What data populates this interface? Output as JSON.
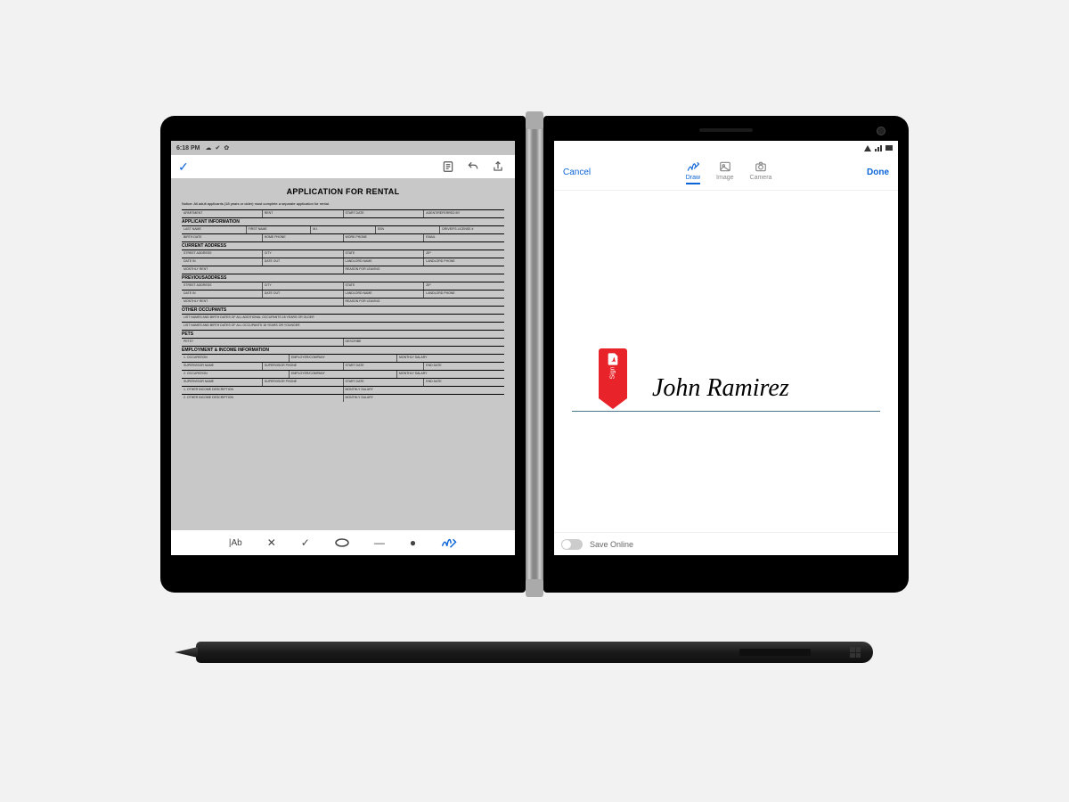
{
  "status": {
    "time": "6:18 PM"
  },
  "left_toolbar": {
    "tools": [
      "properties",
      "undo",
      "share"
    ]
  },
  "document": {
    "title": "APPLICATION FOR RENTAL",
    "notice": "Notice: All adult applicants (18 years or older) must complete a separate application for rental.",
    "row_top": [
      "APARTMENT",
      "RENT",
      "START DATE",
      "AGENT/REFERRED BY"
    ],
    "sections": [
      {
        "heading": "APPLICANT INFORMATION",
        "rows": [
          [
            "LAST NAME",
            "FIRST NAME",
            "M.I.",
            "SSN",
            "DRIVER'S LICENSE #"
          ],
          [
            "BIRTH DATE",
            "HOME PHONE",
            "WORK PHONE",
            "EMAIL"
          ]
        ]
      },
      {
        "heading": "CURRENT ADDRESS",
        "rows": [
          [
            "STREET ADDRESS",
            "CITY",
            "STATE",
            "ZIP"
          ],
          [
            "DATE IN",
            "DATE OUT",
            "LANDLORD NAME",
            "LANDLORD PHONE"
          ],
          [
            "MONTHLY RENT",
            "REASON FOR LEAVING"
          ]
        ]
      },
      {
        "heading": "PREVIOUSADDRESS",
        "rows": [
          [
            "STREET ADDRESS",
            "CITY",
            "STATE",
            "ZIP"
          ],
          [
            "DATE IN",
            "DATE OUT",
            "LANDLORD NAME",
            "LANDLORD PHONE"
          ],
          [
            "MONTHLY RENT",
            "REASON FOR LEAVING"
          ]
        ]
      },
      {
        "heading": "OTHER OCCUPANTS",
        "rows": [
          [
            "LIST NAMES AND BIRTH DATES OF ALL ADDITIONAL OCCUPANTS 18 YEARS OR OLDER"
          ],
          [
            "LIST NAMES AND BIRTH DATES OF ALL OCCUPANTS 18 YEARS OR YOUNGER"
          ]
        ]
      },
      {
        "heading": "PETS",
        "rows": [
          [
            "PETS?",
            "DESCRIBE"
          ]
        ]
      },
      {
        "heading": "EMPLOYMENT & INCOME INFORMATION",
        "rows": [
          [
            "1. OCCUPATION",
            "EMPLOYER/COMPANY",
            "MONTHLY SALARY"
          ],
          [
            "SUPERVISOR NAME",
            "SUPERVISOR PHONE",
            "START DATE",
            "END DATE"
          ],
          [
            "2. OCCUPATION",
            "EMPLOYER/COMPANY",
            "MONTHLY SALARY"
          ],
          [
            "SUPERVISOR NAME",
            "SUPERVISOR PHONE",
            "START DATE",
            "END DATE"
          ],
          [
            "1. OTHER INCOME DESCRIPTION",
            "MONTHLY SALARY"
          ],
          [
            "2. OTHER INCOME DESCRIPTION",
            "MONTHLY SALARY"
          ]
        ]
      }
    ]
  },
  "bottom_tools": [
    "text",
    "strike",
    "check",
    "ellipse",
    "line",
    "dot",
    "sign"
  ],
  "right_toolbar": {
    "cancel": "Cancel",
    "done": "Done",
    "tabs": [
      {
        "label": "Draw",
        "active": true
      },
      {
        "label": "Image",
        "active": false
      },
      {
        "label": "Camera",
        "active": false
      }
    ]
  },
  "signature": {
    "text": "John Ramirez",
    "ribbon_label": "Sign"
  },
  "save": {
    "label": "Save Online",
    "on": false
  }
}
